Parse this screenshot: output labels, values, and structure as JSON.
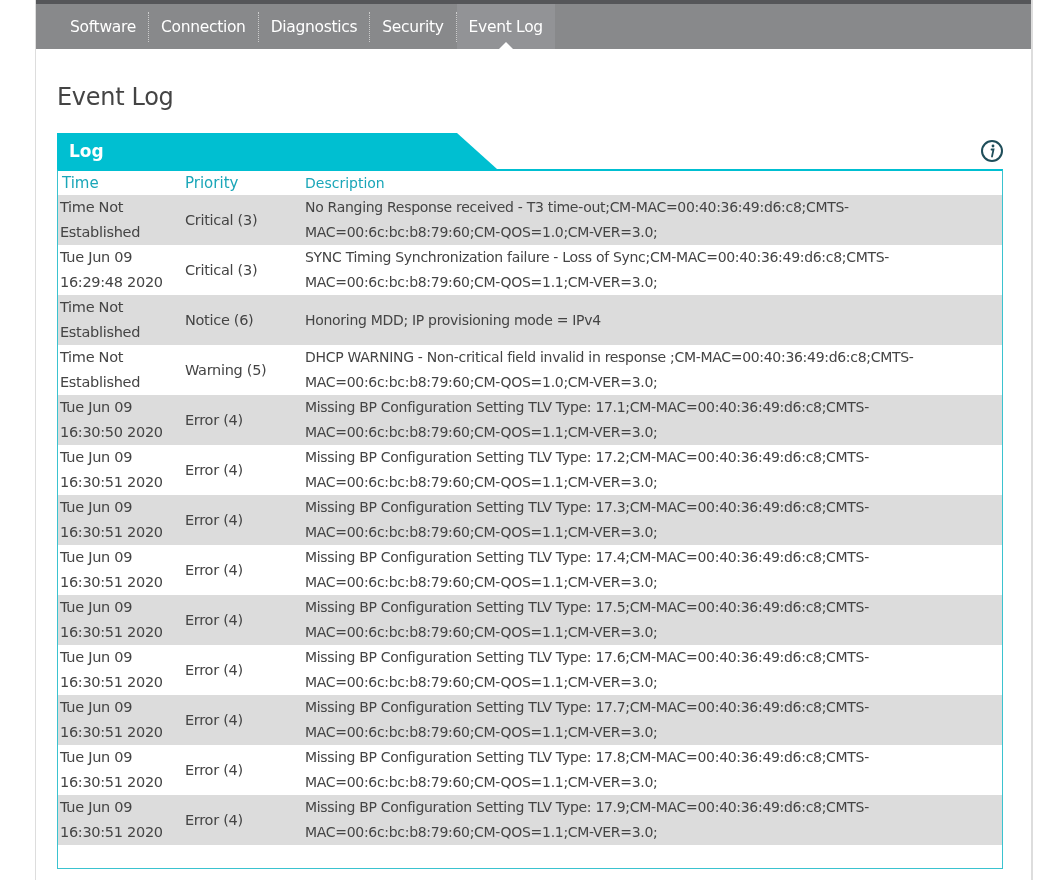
{
  "tabs": [
    {
      "label": "Software",
      "selected": false
    },
    {
      "label": "Connection",
      "selected": false
    },
    {
      "label": "Diagnostics",
      "selected": false
    },
    {
      "label": "Security",
      "selected": false
    },
    {
      "label": "Event Log",
      "selected": true
    }
  ],
  "page_title": "Event Log",
  "log": {
    "title": "Log",
    "columns": [
      "Time",
      "Priority",
      "Description"
    ],
    "rows": [
      {
        "time": "Time Not Established",
        "priority": "Critical (3)",
        "description": "No Ranging Response received - T3 time-out;CM-MAC=00:40:36:49:d6:c8;CMTS-MAC=00:6c:bc:b8:79:60;CM-QOS=1.0;CM-VER=3.0;"
      },
      {
        "time": "Tue Jun 09 16:29:48 2020",
        "priority": "Critical (3)",
        "description": "SYNC Timing Synchronization failure - Loss of Sync;CM-MAC=00:40:36:49:d6:c8;CMTS-MAC=00:6c:bc:b8:79:60;CM-QOS=1.1;CM-VER=3.0;"
      },
      {
        "time": "Time Not Established",
        "priority": "Notice (6)",
        "description": "Honoring MDD; IP provisioning mode = IPv4"
      },
      {
        "time": "Time Not Established",
        "priority": "Warning (5)",
        "description": "DHCP WARNING - Non-critical field invalid in response ;CM-MAC=00:40:36:49:d6:c8;CMTS-MAC=00:6c:bc:b8:79:60;CM-QOS=1.0;CM-VER=3.0;"
      },
      {
        "time": "Tue Jun 09 16:30:50 2020",
        "priority": "Error (4)",
        "description": "Missing BP Configuration Setting TLV Type: 17.1;CM-MAC=00:40:36:49:d6:c8;CMTS-MAC=00:6c:bc:b8:79:60;CM-QOS=1.1;CM-VER=3.0;"
      },
      {
        "time": "Tue Jun 09 16:30:51 2020",
        "priority": "Error (4)",
        "description": "Missing BP Configuration Setting TLV Type: 17.2;CM-MAC=00:40:36:49:d6:c8;CMTS-MAC=00:6c:bc:b8:79:60;CM-QOS=1.1;CM-VER=3.0;"
      },
      {
        "time": "Tue Jun 09 16:30:51 2020",
        "priority": "Error (4)",
        "description": "Missing BP Configuration Setting TLV Type: 17.3;CM-MAC=00:40:36:49:d6:c8;CMTS-MAC=00:6c:bc:b8:79:60;CM-QOS=1.1;CM-VER=3.0;"
      },
      {
        "time": "Tue Jun 09 16:30:51 2020",
        "priority": "Error (4)",
        "description": "Missing BP Configuration Setting TLV Type: 17.4;CM-MAC=00:40:36:49:d6:c8;CMTS-MAC=00:6c:bc:b8:79:60;CM-QOS=1.1;CM-VER=3.0;"
      },
      {
        "time": "Tue Jun 09 16:30:51 2020",
        "priority": "Error (4)",
        "description": "Missing BP Configuration Setting TLV Type: 17.5;CM-MAC=00:40:36:49:d6:c8;CMTS-MAC=00:6c:bc:b8:79:60;CM-QOS=1.1;CM-VER=3.0;"
      },
      {
        "time": "Tue Jun 09 16:30:51 2020",
        "priority": "Error (4)",
        "description": "Missing BP Configuration Setting TLV Type: 17.6;CM-MAC=00:40:36:49:d6:c8;CMTS-MAC=00:6c:bc:b8:79:60;CM-QOS=1.1;CM-VER=3.0;"
      },
      {
        "time": "Tue Jun 09 16:30:51 2020",
        "priority": "Error (4)",
        "description": "Missing BP Configuration Setting TLV Type: 17.7;CM-MAC=00:40:36:49:d6:c8;CMTS-MAC=00:6c:bc:b8:79:60;CM-QOS=1.1;CM-VER=3.0;"
      },
      {
        "time": "Tue Jun 09 16:30:51 2020",
        "priority": "Error (4)",
        "description": "Missing BP Configuration Setting TLV Type: 17.8;CM-MAC=00:40:36:49:d6:c8;CMTS-MAC=00:6c:bc:b8:79:60;CM-QOS=1.1;CM-VER=3.0;"
      },
      {
        "time": "Tue Jun 09 16:30:51 2020",
        "priority": "Error (4)",
        "description": "Missing BP Configuration Setting TLV Type: 17.9;CM-MAC=00:40:36:49:d6:c8;CMTS-MAC=00:6c:bc:b8:79:60;CM-QOS=1.1;CM-VER=3.0;"
      }
    ]
  }
}
